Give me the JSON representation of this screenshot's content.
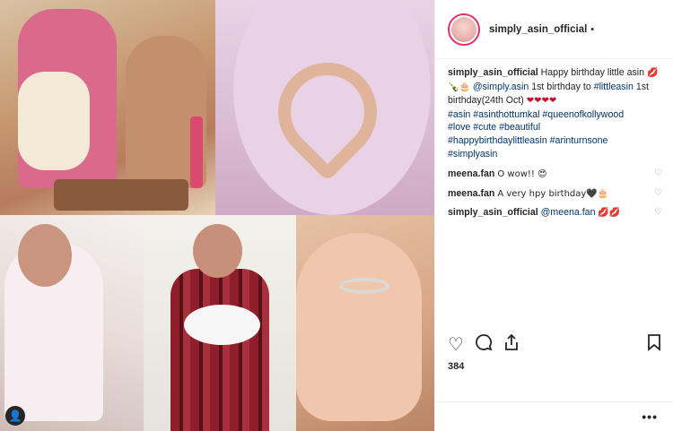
{
  "post": {
    "username": "simply_asin_official",
    "header_dot": "•",
    "caption": {
      "username": "simply_asin_official",
      "text_start": "Happy birthday little asin",
      "emoji_1": "💋🍾🎂",
      "mention": "@simply.asin",
      "text_mid": "1st birthday to",
      "hashtag_little": "#littleasin",
      "text_date": "1st birthday(24th Oct)",
      "hearts": "❤❤❤❤",
      "hashtags_line1": "#asin #asinthottumkal #queenofkollywood",
      "hashtags_line2": "#love #cute #beautiful",
      "hashtags_line3": "#happybirthdaylittleasin #arinturnsone",
      "hashtags_line4": "#simplyasin"
    },
    "comments": [
      {
        "user": "meena.fan",
        "text": "O wow!! 😍"
      },
      {
        "user": "meena.fan",
        "text": "A very hpy birthday🖤🎂"
      },
      {
        "user": "simply_asin_official",
        "mention": "@meena.fan",
        "text": "💋💋"
      }
    ],
    "likes": "384",
    "more_label": "•••"
  },
  "icons": {
    "like": "heart-outline-icon",
    "comment": "comment-bubble-icon",
    "share": "share-icon",
    "save": "bookmark-icon",
    "tag": "user-tag-icon"
  },
  "colors": {
    "accent": "#e1306c",
    "link": "#003569",
    "text": "#262626"
  }
}
